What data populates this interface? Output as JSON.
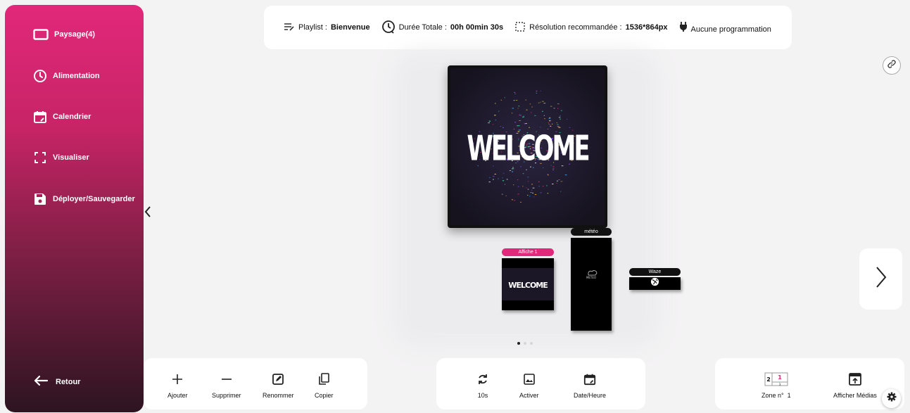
{
  "sidebar": {
    "items": [
      {
        "label": "Paysage(4)",
        "icon": "screen-landscape-icon"
      },
      {
        "label": "Alimentation",
        "icon": "clock-icon"
      },
      {
        "label": "Calendrier",
        "icon": "calendar-edit-icon"
      },
      {
        "label": "Visualiser",
        "icon": "fullscreen-icon"
      },
      {
        "label": "Déployer/Sauvegarder",
        "icon": "save-icon"
      }
    ],
    "back_label": "Retour",
    "gradient": [
      "#e2287a",
      "#7c1f44",
      "#2d1420"
    ]
  },
  "topbar": {
    "playlist_prefix": "Playlist :",
    "playlist_name": "Bienvenue",
    "duration_prefix": "Durée Totale :",
    "duration_value": "00h 00min 30s",
    "resolution_prefix": "Résolution recommandée :",
    "resolution_value": "1536*864px",
    "schedule": "Aucune programmation"
  },
  "preview": {
    "main_text": "WELCOME",
    "zones": [
      {
        "label": "Affiche 1",
        "label_color": "#e2287a",
        "content": "WELCOME"
      },
      {
        "label": "météo",
        "label_color": "#111111",
        "content": "METEO"
      },
      {
        "label": "Waze",
        "label_color": "#111111",
        "content": "globe-icon"
      }
    ],
    "pager": {
      "total": 3,
      "active": 1
    }
  },
  "toolbar_left": [
    {
      "label": "Ajouter",
      "icon": "plus-icon"
    },
    {
      "label": "Supprimer",
      "icon": "minus-icon"
    },
    {
      "label": "Renommer",
      "icon": "edit-icon"
    },
    {
      "label": "Copier",
      "icon": "copy-icon"
    }
  ],
  "toolbar_middle": [
    {
      "label": "10s",
      "icon": "refresh-icon"
    },
    {
      "label": "Activer",
      "icon": "image-icon"
    },
    {
      "label": "Date/Heure",
      "icon": "calendar-edit-icon"
    }
  ],
  "toolbar_right": {
    "zone_label": "Zone n°",
    "zone_number": "1",
    "zone_grid": [
      "2",
      "1",
      "3"
    ],
    "show_media_label": "Afficher Médias"
  },
  "colors": {
    "accent": "#e2287a",
    "background": "#f4f3f4"
  }
}
